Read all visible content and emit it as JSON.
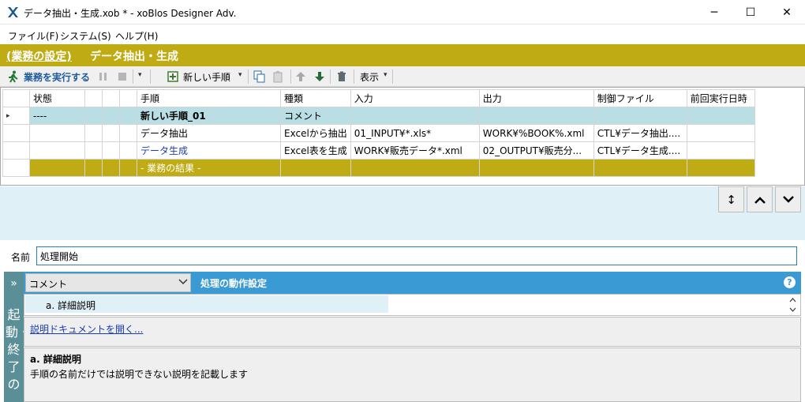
{
  "window": {
    "title": "データ抽出・生成.xob * - xoBlos Designer Adv.",
    "min": "─",
    "max": "☐",
    "close": "✕"
  },
  "menu": [
    "ファイル(F)",
    "システム(S)",
    "ヘルプ(H)"
  ],
  "header": {
    "settings_link": "(業務の設定)",
    "title": "データ抽出・生成"
  },
  "toolbar": {
    "run_label": "業務を実行する",
    "new_step_label": "新しい手順",
    "view_label": "表示",
    "dropdown": "▾"
  },
  "grid": {
    "columns": [
      "",
      "状態",
      "",
      "",
      "",
      "手順",
      "種類",
      "入力",
      "出力",
      "制御ファイル",
      "前回実行日時"
    ],
    "rows": [
      {
        "marker": "▸",
        "status": "----",
        "step": "新しい手順_01",
        "type": "コメント",
        "input": "",
        "output": "",
        "control": "",
        "last": ""
      },
      {
        "marker": "",
        "status": "",
        "step": "データ抽出",
        "type": "Excelから抽出",
        "input": "01_INPUT¥*.xls*",
        "output": "WORK¥%BOOK%.xml",
        "control": "CTL¥データ抽出....",
        "last": ""
      },
      {
        "marker": "",
        "status": "",
        "step": "データ生成",
        "type": "Excel表を生成",
        "input": "WORK¥販売データ*.xml",
        "output": "02_OUTPUT¥販売分...",
        "control": "CTL¥データ生成....",
        "last": ""
      }
    ],
    "result_label": "- 業務の結果 -"
  },
  "nav": {
    "resize": "↕",
    "up": "˄",
    "down": "˅"
  },
  "name_field": {
    "label": "名前",
    "value": "処理開始"
  },
  "panel": {
    "side_arrow": "»",
    "side_text": "起動・終了の",
    "select_value": "コメント",
    "title": "処理の動作設定",
    "help": "?",
    "list_item": "a. 詳細説明",
    "doc_link": "説明ドキュメントを開く...",
    "desc_title": "a. 詳細説明",
    "desc_text": "手順の名前だけでは説明できない説明を記載します"
  },
  "colors": {
    "gold": "#bfab14",
    "blue": "#3a9ad4",
    "teal": "#5b8f98",
    "selected_row": "#b9dfe4"
  }
}
